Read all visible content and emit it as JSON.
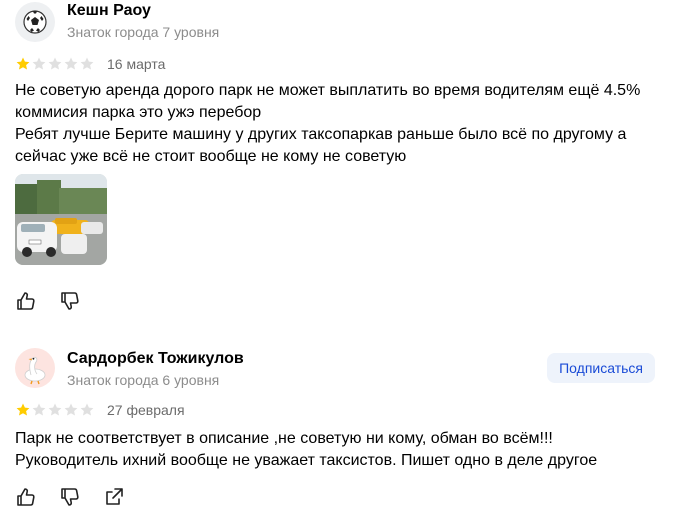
{
  "reviews": [
    {
      "author": "Кешн Раоу",
      "level": "Знаток города 7 уровня",
      "avatar_icon": "soccer-ball-icon",
      "rating": 1,
      "date": "16 марта",
      "text_lines": [
        "Не советую аренда дорого парк не может выплатить во время водителям ещё 4.5%",
        "коммисия парка это ужэ перебор",
        "Ребят лучше Берите машину у других таксопаркав раньше было всё по другому а",
        "сейчас уже всё не стоит вообще не кому не советую"
      ],
      "has_photo": true
    },
    {
      "author": "Сардорбек Тожикулов",
      "level": "Знаток города 6 уровня",
      "avatar_icon": "goose-icon",
      "subscribe_label": "Подписаться",
      "rating": 1,
      "date": "27 февраля",
      "text_lines": [
        "Парк не соответствует в описание ,не советую ни кому, обман во всём!!!",
        "Руководитель ихний вообще не уважает таксистов. Пишет одно в деле другое"
      ],
      "has_photo": false
    }
  ],
  "colors": {
    "star_filled": "#fc0",
    "star_empty": "#e0e0e0",
    "subscribe_text": "#1a4bd6",
    "subscribe_bg": "#eef3fb",
    "muted_text": "#8c8c8c"
  },
  "icons": [
    "like-icon",
    "dislike-icon",
    "share-icon"
  ]
}
